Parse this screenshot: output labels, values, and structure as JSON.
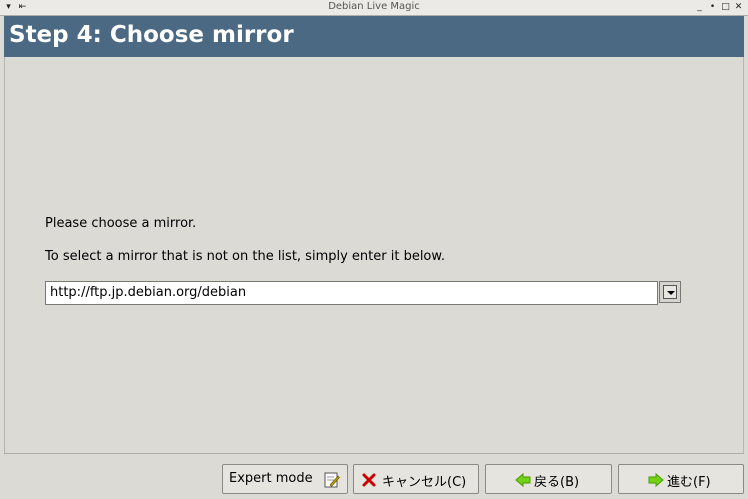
{
  "window": {
    "title": "Debian Live Magic"
  },
  "header": {
    "title": "Step 4: Choose mirror"
  },
  "content": {
    "prompt": "Please choose a mirror.",
    "hint": "To select a mirror that is not on the list, simply enter it below.",
    "mirror_value": "http://ftp.jp.debian.org/debian"
  },
  "buttons": {
    "expert_mode": "Expert mode",
    "cancel": "キャンセル(C)",
    "back": "戻る(B)",
    "next": "進む(F)"
  },
  "icons": {
    "window_menu": "chevron-down-icon",
    "pin": "pin-icon",
    "minimize": "minimize-icon",
    "maximize": "maximize-icon",
    "close": "close-icon",
    "expert": "edit-icon",
    "cancel": "cancel-x-icon",
    "back": "arrow-left-icon",
    "next": "arrow-right-icon"
  },
  "colors": {
    "header_bg": "#4b6983",
    "window_bg": "#dcdad5",
    "arrow_green": "#4e9a06",
    "cancel_red": "#cc0000"
  }
}
